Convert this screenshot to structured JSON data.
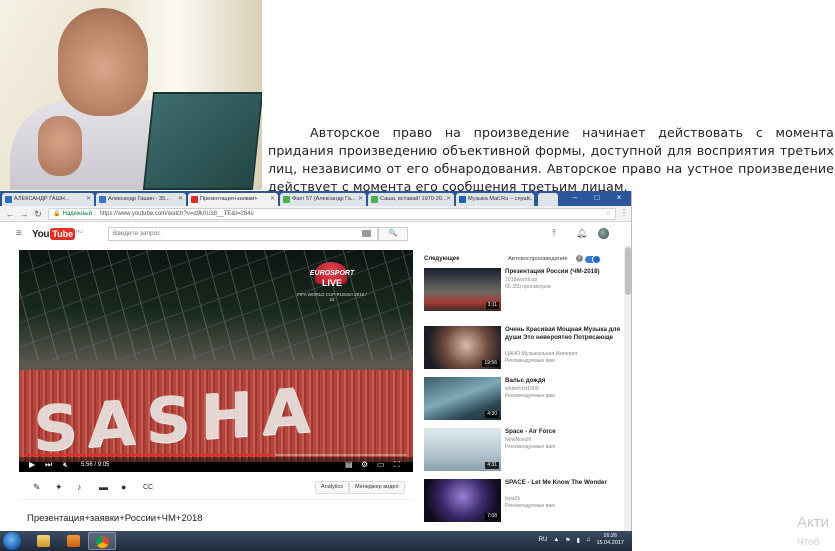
{
  "quote": {
    "text": "Авторское право на произведение начинает действовать с момента придания произведению объективной формы, доступной для восприятия третьих лиц, независимо от его обнародования. Авторское право на устное произведение действует с момента его сообщения третьим лицам."
  },
  "browser": {
    "tabs": [
      {
        "label": "АЛЕКСАНДР ГАШН...",
        "color": "#2b6cc4"
      },
      {
        "label": "Александр Гашин - 35...",
        "color": "#3a75c4"
      },
      {
        "label": "Презентация+заявки+",
        "color": "#e52d27",
        "active": true
      },
      {
        "label": "Факт 57 (Александр Га...",
        "color": "#4caf50"
      },
      {
        "label": "Саша, вставай! 1970-20...",
        "color": "#4caf50"
      },
      {
        "label": "Музыка Mail.Ru – слуш...",
        "color": "#1d5fb4"
      }
    ],
    "window_controls": [
      "–",
      "□",
      "×"
    ],
    "secure_label": "Надежный",
    "url": "https://www.youtube.com/watch?v=d9k0Us8__TE&t=284s"
  },
  "youtube": {
    "logo_you": "You",
    "logo_tube": "Tube",
    "logo_cc": "RU",
    "search_placeholder": "Введите запрос",
    "search_icon": "🔍",
    "player": {
      "overlay_text": "SASHA",
      "channel_logo_top": "EURO",
      "channel_logo_main": "SPORT",
      "channel_logo_live": "LIVE",
      "channel_logo_sub": "FIFA WORLD CUP RUSSIA 2018 / 22",
      "time_current": "5:56",
      "time_sep": " / ",
      "time_total": "9:05",
      "progress_fraction": 0.654
    },
    "action_buttons": {
      "analytics": "Analytics",
      "manager": "Менеджер видео"
    },
    "video_title": "Презентация+заявки+России+ЧМ+2018",
    "up_next_label": "Следующее",
    "autoplay_label": "Автовоспроизведение",
    "info_glyph": "i",
    "sidebar": [
      {
        "title": "Презентация России (ЧМ-2018)",
        "meta1": "2018worldcup",
        "meta2": "65 350 просмотров",
        "duration": "3:11"
      },
      {
        "title": "Очень Красивая Мощная Музыка для души Это невероятно Потрясающе",
        "meta1": "ЦАНО Музыкальная Империя",
        "meta2": "Рекомендуемые вам",
        "duration": "19:56"
      },
      {
        "title": "Вальс дождя",
        "meta1": "whitefrost1000",
        "meta2": "Рекомендуемые вам",
        "duration": "4:30"
      },
      {
        "title": "Space - Air Force",
        "meta1": "NewNoschi",
        "meta2": "Рекомендуемые вам",
        "duration": "4:31"
      },
      {
        "title": "SPACE - Let Me Know The Wonder",
        "meta1": "lepa2k",
        "meta2": "Рекомендуемые вам",
        "duration": "7:08"
      }
    ]
  },
  "taskbar": {
    "lang": "RU",
    "time": "16:26",
    "date": "15.04.2017"
  },
  "watermark": {
    "line1": "Акти",
    "line2": "Чтоб"
  }
}
